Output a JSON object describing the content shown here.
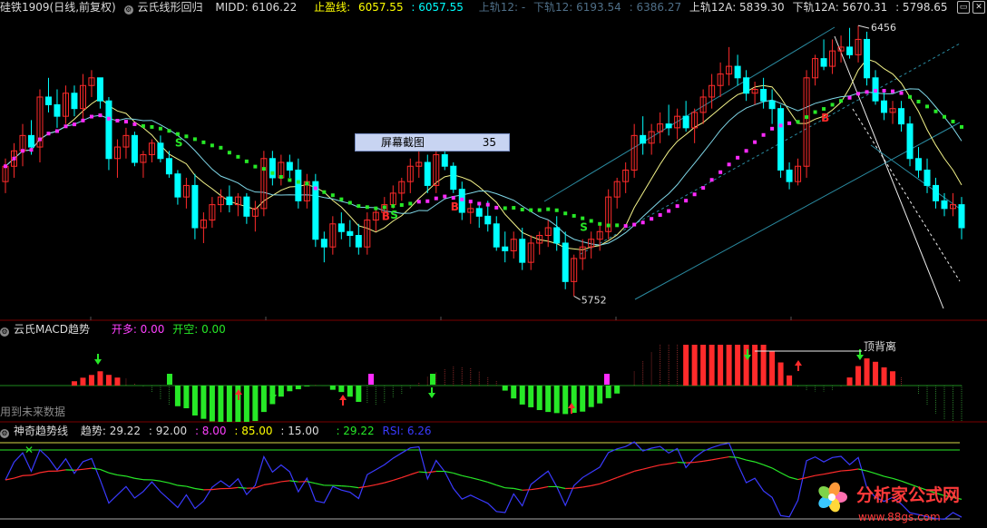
{
  "main_panel": {
    "title": "硅铁1909(日线,前复权)",
    "indicator": "云氏线形回归",
    "midd": "MIDD: 6106.22",
    "stop_profit": "止盈线:",
    "stop_profit_v1": "6057.55",
    "stop_profit_v2": ": 6057.55",
    "upper12": "上轨12: -",
    "lower12": "下轨12: 6193.54",
    "v6386": ": 6386.27",
    "upper12a": "上轨12A: 5839.30",
    "lower12a": "下轨12A: 5670.31",
    "v5798": ": 5798.65",
    "high_mark": "6456",
    "low_mark": "5752",
    "tooltip_title": "屏幕截图",
    "tooltip_value": "35",
    "signals": [
      "S",
      "B",
      "S",
      "B",
      "S",
      "B",
      "S"
    ]
  },
  "macd_panel": {
    "title": "云氏MACD趋势",
    "open_long": "开多: 0.00",
    "open_short": "开空: 0.00",
    "divergence": "顶背离",
    "future_note": "用到未来数据"
  },
  "trend_panel": {
    "title": "神奇趋势线",
    "trend": "趋势: 29.22",
    "v1": ": 92.00",
    "v2": ": 8.00",
    "v3": ": 85.00",
    "v4": ": 15.00",
    "v5": ": 29.22",
    "rsi": "RSI: 6.26"
  },
  "watermark": {
    "text": "分析家公式网",
    "url": "www.88gs.com"
  },
  "colors": {
    "up": "#ff2b2b",
    "down": "#00ffff",
    "magenta": "#ff2bff",
    "green": "#27e827",
    "yellow": "#ffff66",
    "divider": "#7a0000"
  },
  "candles": [
    [
      6050,
      6110,
      6020,
      6090
    ],
    [
      6090,
      6150,
      6060,
      6130
    ],
    [
      6130,
      6200,
      6090,
      6170
    ],
    [
      6170,
      6210,
      6120,
      6140
    ],
    [
      6140,
      6290,
      6100,
      6270
    ],
    [
      6270,
      6320,
      6230,
      6250
    ],
    [
      6250,
      6290,
      6190,
      6220
    ],
    [
      6220,
      6300,
      6200,
      6280
    ],
    [
      6280,
      6300,
      6220,
      6240
    ],
    [
      6240,
      6330,
      6210,
      6300
    ],
    [
      6300,
      6340,
      6270,
      6320
    ],
    [
      6320,
      6310,
      6240,
      6260
    ],
    [
      6260,
      6270,
      6080,
      6110
    ],
    [
      6110,
      6160,
      6060,
      6140
    ],
    [
      6140,
      6190,
      6110,
      6170
    ],
    [
      6170,
      6180,
      6090,
      6100
    ],
    [
      6100,
      6130,
      6060,
      6120
    ],
    [
      6120,
      6160,
      6100,
      6150
    ],
    [
      6150,
      6170,
      6100,
      6110
    ],
    [
      6110,
      6130,
      6060,
      6070
    ],
    [
      6070,
      6080,
      5990,
      6010
    ],
    [
      6010,
      6060,
      5980,
      6040
    ],
    [
      6040,
      6070,
      5900,
      5930
    ],
    [
      5930,
      5970,
      5890,
      5950
    ],
    [
      5950,
      6010,
      5930,
      5990
    ],
    [
      5990,
      6030,
      5970,
      6010
    ],
    [
      6010,
      6040,
      5970,
      5990
    ],
    [
      5990,
      6020,
      5960,
      6010
    ],
    [
      6010,
      6020,
      5940,
      5960
    ],
    [
      5960,
      6000,
      5920,
      5980
    ],
    [
      5980,
      6130,
      5960,
      6110
    ],
    [
      6110,
      6130,
      6040,
      6060
    ],
    [
      6060,
      6120,
      6040,
      6100
    ],
    [
      6100,
      6120,
      6060,
      6080
    ],
    [
      6080,
      6110,
      5980,
      6000
    ],
    [
      6000,
      6070,
      5980,
      6050
    ],
    [
      6050,
      6070,
      5880,
      5900
    ],
    [
      5900,
      5920,
      5840,
      5880
    ],
    [
      5880,
      5960,
      5860,
      5940
    ],
    [
      5940,
      5970,
      5900,
      5920
    ],
    [
      5920,
      5950,
      5880,
      5910
    ],
    [
      5910,
      5940,
      5860,
      5880
    ],
    [
      5880,
      5970,
      5860,
      5950
    ],
    [
      5950,
      5980,
      5920,
      5970
    ],
    [
      5970,
      6010,
      5950,
      5990
    ],
    [
      5990,
      6040,
      5980,
      6020
    ],
    [
      6020,
      6060,
      6000,
      6050
    ],
    [
      6050,
      6110,
      6020,
      6090
    ],
    [
      6090,
      6140,
      6060,
      6100
    ],
    [
      6100,
      6120,
      6020,
      6040
    ],
    [
      6040,
      6140,
      6020,
      6120
    ],
    [
      6120,
      6170,
      6080,
      6090
    ],
    [
      6090,
      6100,
      6020,
      6030
    ],
    [
      6030,
      6050,
      5950,
      5970
    ],
    [
      5970,
      6000,
      5940,
      5980
    ],
    [
      5980,
      5990,
      5930,
      5960
    ],
    [
      5960,
      6000,
      5920,
      5940
    ],
    [
      5940,
      5960,
      5870,
      5880
    ],
    [
      5880,
      5920,
      5840,
      5870
    ],
    [
      5870,
      5920,
      5850,
      5900
    ],
    [
      5900,
      5930,
      5820,
      5840
    ],
    [
      5840,
      5910,
      5820,
      5890
    ],
    [
      5890,
      5920,
      5860,
      5910
    ],
    [
      5910,
      5950,
      5880,
      5930
    ],
    [
      5930,
      5960,
      5870,
      5890
    ],
    [
      5890,
      5920,
      5770,
      5790
    ],
    [
      5790,
      5860,
      5752,
      5850
    ],
    [
      5850,
      5900,
      5820,
      5880
    ],
    [
      5880,
      5920,
      5850,
      5900
    ],
    [
      5900,
      5940,
      5870,
      5920
    ],
    [
      5920,
      6030,
      5900,
      6010
    ],
    [
      6010,
      6060,
      5980,
      6050
    ],
    [
      6050,
      6100,
      6020,
      6080
    ],
    [
      6080,
      6200,
      6060,
      6170
    ],
    [
      6170,
      6220,
      6120,
      6150
    ],
    [
      6150,
      6200,
      6120,
      6180
    ],
    [
      6180,
      6230,
      6150,
      6200
    ],
    [
      6200,
      6250,
      6170,
      6190
    ],
    [
      6190,
      6240,
      6160,
      6220
    ],
    [
      6220,
      6260,
      6180,
      6190
    ],
    [
      6190,
      6240,
      6150,
      6230
    ],
    [
      6230,
      6290,
      6200,
      6270
    ],
    [
      6270,
      6330,
      6240,
      6300
    ],
    [
      6300,
      6360,
      6270,
      6330
    ],
    [
      6330,
      6400,
      6300,
      6350
    ],
    [
      6350,
      6380,
      6300,
      6320
    ],
    [
      6320,
      6340,
      6260,
      6280
    ],
    [
      6280,
      6310,
      6250,
      6290
    ],
    [
      6290,
      6320,
      6240,
      6260
    ],
    [
      6260,
      6290,
      6200,
      6240
    ],
    [
      6240,
      6250,
      6060,
      6080
    ],
    [
      6080,
      6100,
      6030,
      6050
    ],
    [
      6050,
      6110,
      6040,
      6090
    ],
    [
      6090,
      6340,
      6060,
      6320
    ],
    [
      6320,
      6380,
      6300,
      6370
    ],
    [
      6370,
      6420,
      6340,
      6350
    ],
    [
      6350,
      6420,
      6330,
      6390
    ],
    [
      6390,
      6430,
      6360,
      6400
    ],
    [
      6400,
      6450,
      6370,
      6380
    ],
    [
      6380,
      6456,
      6360,
      6420
    ],
    [
      6420,
      6440,
      6300,
      6320
    ],
    [
      6320,
      6340,
      6250,
      6260
    ],
    [
      6260,
      6290,
      6210,
      6230
    ],
    [
      6230,
      6260,
      6200,
      6240
    ],
    [
      6240,
      6260,
      6180,
      6200
    ],
    [
      6200,
      6220,
      6090,
      6110
    ],
    [
      6110,
      6140,
      6060,
      6080
    ],
    [
      6080,
      6110,
      6020,
      6040
    ],
    [
      6040,
      6060,
      5980,
      6000
    ],
    [
      6000,
      6020,
      5960,
      5980
    ],
    [
      5980,
      6020,
      5960,
      5990
    ],
    [
      5990,
      6010,
      5900,
      5930
    ]
  ]
}
